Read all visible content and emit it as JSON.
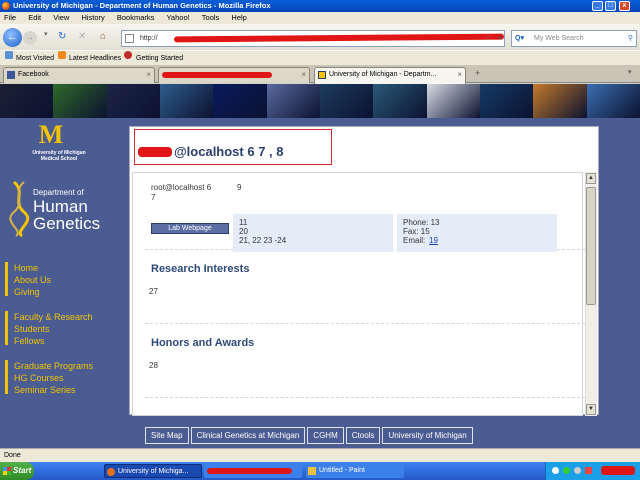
{
  "window": {
    "title": "University of Michigan - Department of Human Genetics - Mozilla Firefox",
    "controls": [
      "_",
      "□",
      "x"
    ]
  },
  "menubar": [
    "File",
    "Edit",
    "View",
    "History",
    "Bookmarks",
    "Yahoo!",
    "Tools",
    "Help"
  ],
  "nav": {
    "url_prefix": "http://",
    "search_placeholder": "My Web Search"
  },
  "bookmarks": [
    "Most Visited",
    "Latest Headlines",
    "Getting Started"
  ],
  "tabs": [
    {
      "label": "Facebook",
      "active": false
    },
    {
      "label": "",
      "active": false
    },
    {
      "label": "University of Michigan - Departm...",
      "active": true
    }
  ],
  "banner_colors": [
    "#1b2036",
    "#2e6a2a",
    "#1d2447",
    "#2f5d8e",
    "#0a1a5e",
    "#5a6aa0",
    "#1c3c5e",
    "#2a5a78",
    "#d8dde6",
    "#153a66",
    "#c47a2a",
    "#3a6fb0"
  ],
  "sidebar": {
    "logo_letter": "M",
    "school_line1": "University of Michigan",
    "school_line2": "Medical School",
    "dept_line1": "Department of",
    "dept_line2": "Human",
    "dept_line3": "Genetics",
    "links_group1": [
      "Home",
      "About Us",
      "Giving"
    ],
    "links_group2": [
      "Faculty & Research",
      "Students",
      "Fellows"
    ],
    "links_group3": [
      "Graduate Programs",
      "HG Courses",
      "Seminar Series"
    ]
  },
  "profile": {
    "heading": "@localhost 6 7 , 8",
    "email_line1": "root@localhost 6",
    "email_line2": "7",
    "field9": "9",
    "lab_button": "Lab Webpage",
    "address": [
      "11",
      "20",
      "21, 22 23 -24"
    ],
    "phone": "Phone: 13",
    "fax": "Fax: 15",
    "email_label": "Email:",
    "email_value": "19",
    "sections": [
      {
        "title": "Research Interests",
        "value": "27"
      },
      {
        "title": "Honors and Awards",
        "value": "28"
      }
    ]
  },
  "footer_links": [
    "Site Map",
    "Clinical Genetics at Michigan",
    "CGHM",
    "Ctools",
    "University of Michigan"
  ],
  "statusbar": {
    "text": "Done"
  },
  "taskbar": {
    "start": "Start",
    "tasks": [
      "University of Michiga...",
      "",
      "Untitled - Paint"
    ]
  },
  "colors": {
    "accent": "#f2c300",
    "site_bg": "#4a5c91",
    "highlight": "#d42a2a"
  }
}
